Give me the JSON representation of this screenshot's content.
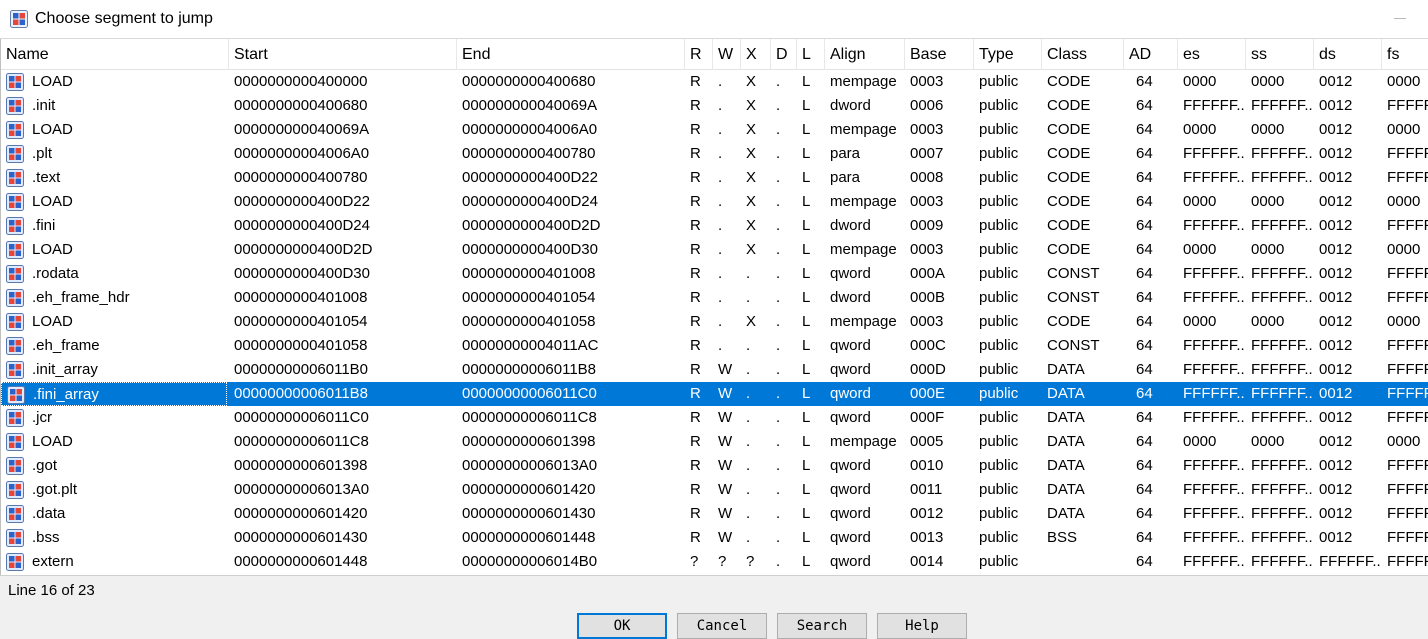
{
  "window": {
    "title": "Choose segment to jump"
  },
  "columns": [
    "Name",
    "Start",
    "End",
    "R",
    "W",
    "X",
    "D",
    "L",
    "Align",
    "Base",
    "Type",
    "Class",
    "AD",
    "es",
    "ss",
    "ds",
    "fs"
  ],
  "rows": [
    [
      "LOAD",
      "0000000000400000",
      "0000000000400680",
      "R",
      ".",
      "X",
      ".",
      "L",
      "mempage",
      "0003",
      "public",
      "CODE",
      "64",
      "0000",
      "0000",
      "0012",
      "0000"
    ],
    [
      ".init",
      "0000000000400680",
      "000000000040069A",
      "R",
      ".",
      "X",
      ".",
      "L",
      "dword",
      "0006",
      "public",
      "CODE",
      "64",
      "FFFFFF...",
      "FFFFFF...",
      "0012",
      "FFFFF"
    ],
    [
      "LOAD",
      "000000000040069A",
      "00000000004006A0",
      "R",
      ".",
      "X",
      ".",
      "L",
      "mempage",
      "0003",
      "public",
      "CODE",
      "64",
      "0000",
      "0000",
      "0012",
      "0000"
    ],
    [
      ".plt",
      "00000000004006A0",
      "0000000000400780",
      "R",
      ".",
      "X",
      ".",
      "L",
      "para",
      "0007",
      "public",
      "CODE",
      "64",
      "FFFFFF...",
      "FFFFFF...",
      "0012",
      "FFFFF"
    ],
    [
      ".text",
      "0000000000400780",
      "0000000000400D22",
      "R",
      ".",
      "X",
      ".",
      "L",
      "para",
      "0008",
      "public",
      "CODE",
      "64",
      "FFFFFF...",
      "FFFFFF...",
      "0012",
      "FFFFF"
    ],
    [
      "LOAD",
      "0000000000400D22",
      "0000000000400D24",
      "R",
      ".",
      "X",
      ".",
      "L",
      "mempage",
      "0003",
      "public",
      "CODE",
      "64",
      "0000",
      "0000",
      "0012",
      "0000"
    ],
    [
      ".fini",
      "0000000000400D24",
      "0000000000400D2D",
      "R",
      ".",
      "X",
      ".",
      "L",
      "dword",
      "0009",
      "public",
      "CODE",
      "64",
      "FFFFFF...",
      "FFFFFF...",
      "0012",
      "FFFFF"
    ],
    [
      "LOAD",
      "0000000000400D2D",
      "0000000000400D30",
      "R",
      ".",
      "X",
      ".",
      "L",
      "mempage",
      "0003",
      "public",
      "CODE",
      "64",
      "0000",
      "0000",
      "0012",
      "0000"
    ],
    [
      ".rodata",
      "0000000000400D30",
      "0000000000401008",
      "R",
      ".",
      ".",
      ".",
      "L",
      "qword",
      "000A",
      "public",
      "CONST",
      "64",
      "FFFFFF...",
      "FFFFFF...",
      "0012",
      "FFFFF"
    ],
    [
      ".eh_frame_hdr",
      "0000000000401008",
      "0000000000401054",
      "R",
      ".",
      ".",
      ".",
      "L",
      "dword",
      "000B",
      "public",
      "CONST",
      "64",
      "FFFFFF...",
      "FFFFFF...",
      "0012",
      "FFFFF"
    ],
    [
      "LOAD",
      "0000000000401054",
      "0000000000401058",
      "R",
      ".",
      "X",
      ".",
      "L",
      "mempage",
      "0003",
      "public",
      "CODE",
      "64",
      "0000",
      "0000",
      "0012",
      "0000"
    ],
    [
      ".eh_frame",
      "0000000000401058",
      "00000000004011AC",
      "R",
      ".",
      ".",
      ".",
      "L",
      "qword",
      "000C",
      "public",
      "CONST",
      "64",
      "FFFFFF...",
      "FFFFFF...",
      "0012",
      "FFFFF"
    ],
    [
      ".init_array",
      "00000000006011B0",
      "00000000006011B8",
      "R",
      "W",
      ".",
      ".",
      "L",
      "qword",
      "000D",
      "public",
      "DATA",
      "64",
      "FFFFFF...",
      "FFFFFF...",
      "0012",
      "FFFFF"
    ],
    [
      ".fini_array",
      "00000000006011B8",
      "00000000006011C0",
      "R",
      "W",
      ".",
      ".",
      "L",
      "qword",
      "000E",
      "public",
      "DATA",
      "64",
      "FFFFFF...",
      "FFFFFF...",
      "0012",
      "FFFFF"
    ],
    [
      ".jcr",
      "00000000006011C0",
      "00000000006011C8",
      "R",
      "W",
      ".",
      ".",
      "L",
      "qword",
      "000F",
      "public",
      "DATA",
      "64",
      "FFFFFF...",
      "FFFFFF...",
      "0012",
      "FFFFF"
    ],
    [
      "LOAD",
      "00000000006011C8",
      "0000000000601398",
      "R",
      "W",
      ".",
      ".",
      "L",
      "mempage",
      "0005",
      "public",
      "DATA",
      "64",
      "0000",
      "0000",
      "0012",
      "0000"
    ],
    [
      ".got",
      "0000000000601398",
      "00000000006013A0",
      "R",
      "W",
      ".",
      ".",
      "L",
      "qword",
      "0010",
      "public",
      "DATA",
      "64",
      "FFFFFF...",
      "FFFFFF...",
      "0012",
      "FFFFF"
    ],
    [
      ".got.plt",
      "00000000006013A0",
      "0000000000601420",
      "R",
      "W",
      ".",
      ".",
      "L",
      "qword",
      "0011",
      "public",
      "DATA",
      "64",
      "FFFFFF...",
      "FFFFFF...",
      "0012",
      "FFFFF"
    ],
    [
      ".data",
      "0000000000601420",
      "0000000000601430",
      "R",
      "W",
      ".",
      ".",
      "L",
      "qword",
      "0012",
      "public",
      "DATA",
      "64",
      "FFFFFF...",
      "FFFFFF...",
      "0012",
      "FFFFF"
    ],
    [
      ".bss",
      "0000000000601430",
      "0000000000601448",
      "R",
      "W",
      ".",
      ".",
      "L",
      "qword",
      "0013",
      "public",
      "BSS",
      "64",
      "FFFFFF...",
      "FFFFFF...",
      "0012",
      "FFFFF"
    ],
    [
      "extern",
      "0000000000601448",
      "00000000006014B0",
      "?",
      "?",
      "?",
      ".",
      "L",
      "qword",
      "0014",
      "public",
      "",
      "64",
      "FFFFFF...",
      "FFFFFF...",
      "FFFFFF...",
      "FFFFF"
    ]
  ],
  "selected_row_index": 13,
  "status": {
    "line_text": "Line 16 of 23"
  },
  "buttons": {
    "ok": "OK",
    "cancel": "Cancel",
    "search": "Search",
    "help": "Help"
  },
  "icons": {
    "window": "ida-window-icon",
    "segment": "segment-icon"
  },
  "colors": {
    "selection": "#0078d7",
    "default_button_border": "#0078d7"
  }
}
